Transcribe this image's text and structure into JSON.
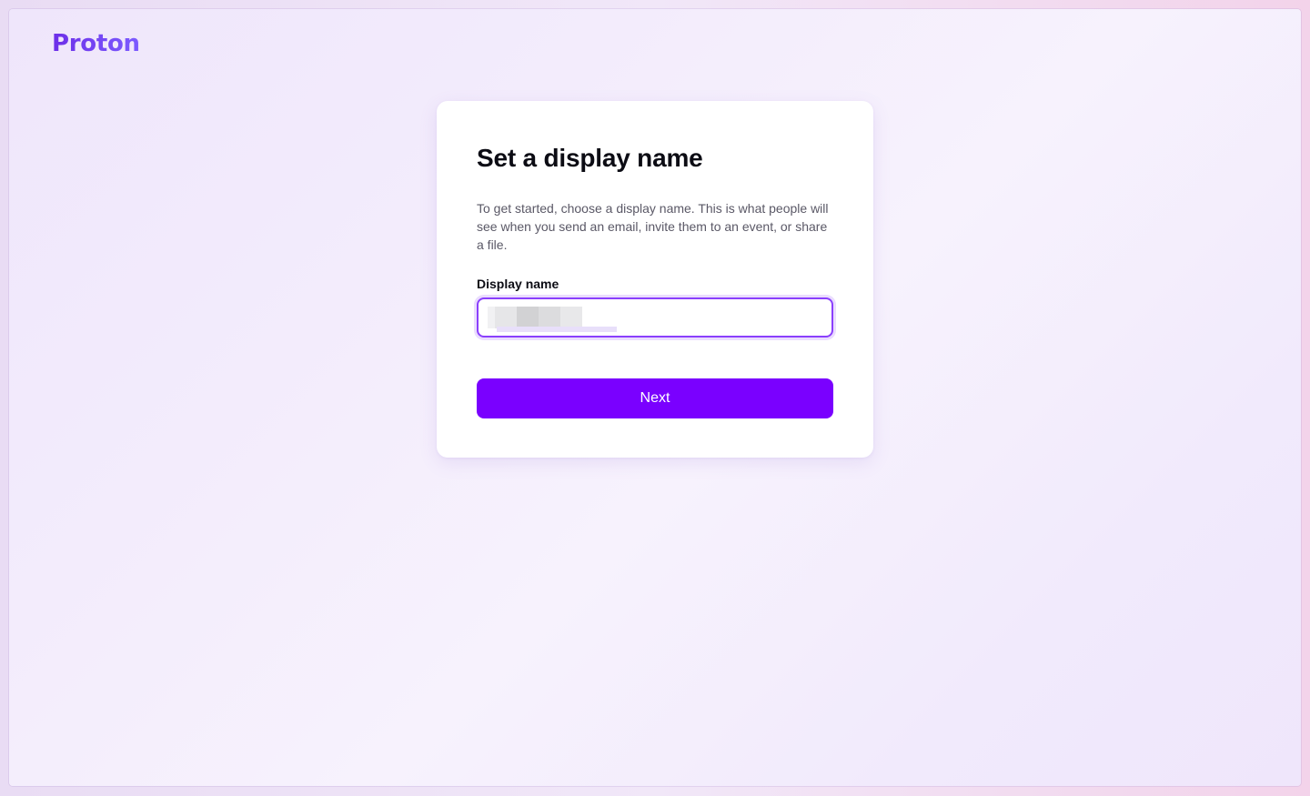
{
  "brand": {
    "logo_text": "Proton",
    "accent_color": "#7a00ff"
  },
  "card": {
    "title": "Set a display name",
    "description": "To get started, choose a display name. This is what people will see when you send an email, invite them to an event, or share a file.",
    "field_label": "Display name",
    "input_value": "",
    "next_label": "Next"
  }
}
